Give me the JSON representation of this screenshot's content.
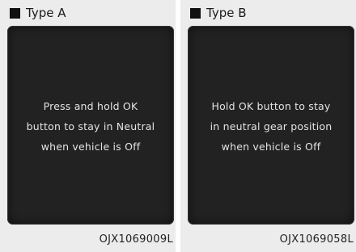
{
  "panels": [
    {
      "label": "Type A",
      "message": [
        "Press and hold OK",
        "button to stay in Neutral",
        "when vehicle is Off"
      ],
      "code": "OJX1069009L"
    },
    {
      "label": "Type B",
      "message": [
        "Hold OK button to stay",
        "in neutral gear position",
        "when vehicle is Off"
      ],
      "code": "OJX1069058L"
    }
  ],
  "colors": {
    "panel_bg": "#ececec",
    "screen_bg": "#222222",
    "screen_text": "#e4e4e4",
    "bullet": "#111111"
  },
  "icons": [
    "square-bullet-icon"
  ]
}
